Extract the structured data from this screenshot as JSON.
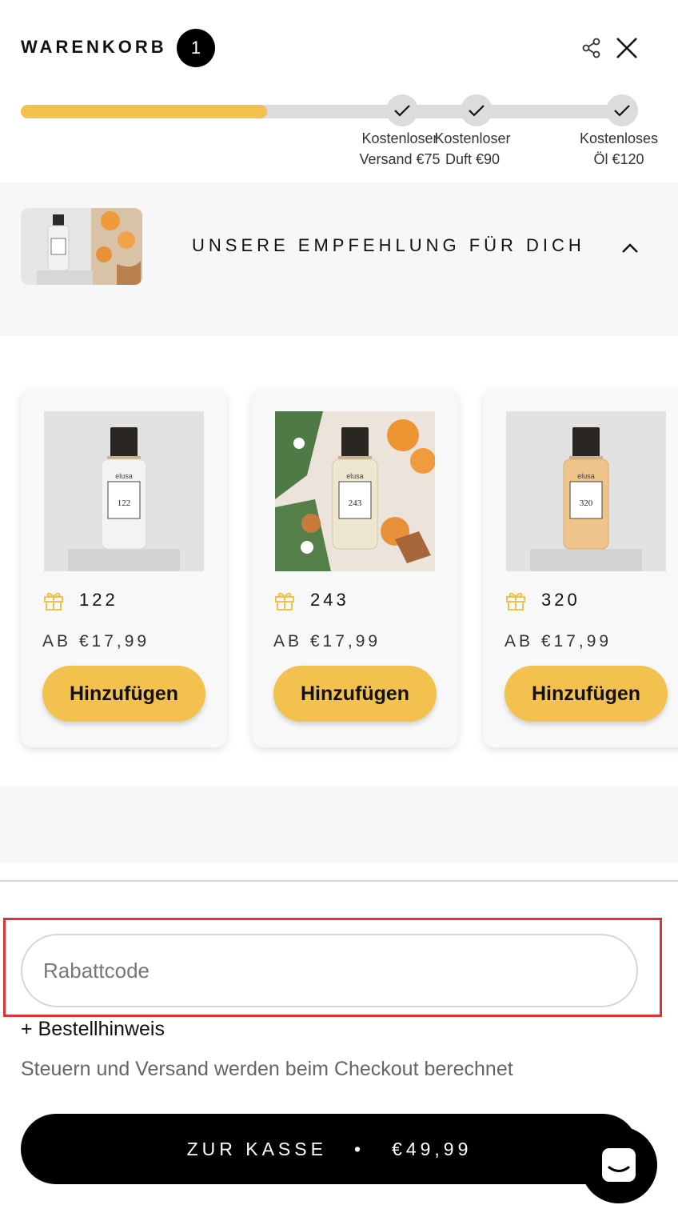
{
  "header": {
    "title": "WARENKORB",
    "item_count": "1"
  },
  "progress": {
    "value_fraction": 0.4,
    "milestones": [
      {
        "line1": "Kostenloser",
        "line2": "Versand €75"
      },
      {
        "line1": "Kostenloser",
        "line2": "Duft €90"
      },
      {
        "line1": "Kostenloses",
        "line2": "Öl €120"
      }
    ]
  },
  "recommendations": {
    "title": "UNSERE EMPFEHLUNG FÜR DICH",
    "products": [
      {
        "name": "122",
        "price": "AB €17,99",
        "button": "Hinzufügen",
        "label": "122"
      },
      {
        "name": "243",
        "price": "AB €17,99",
        "button": "Hinzufügen",
        "label": "243"
      },
      {
        "name": "320",
        "price": "AB €17,99",
        "button": "Hinzufügen",
        "label": "320"
      }
    ],
    "bottle_brand": "elusa"
  },
  "footer": {
    "coupon_placeholder": "Rabattcode",
    "order_note_link": "+ Bestellhinweis",
    "tax_note": "Steuern und Versand werden beim Checkout berechnet",
    "checkout_label": "ZUR KASSE",
    "checkout_separator": "•",
    "checkout_total": "€49,99"
  },
  "icons": {
    "share": "share-icon",
    "close": "close-icon",
    "check": "check-icon",
    "chevron": "chevron-up-icon",
    "gift": "gift-icon",
    "chat": "chat-icon"
  },
  "colors": {
    "accent": "#f2c14e",
    "highlight": "#e0332f",
    "checkout_bg": "#000000"
  }
}
